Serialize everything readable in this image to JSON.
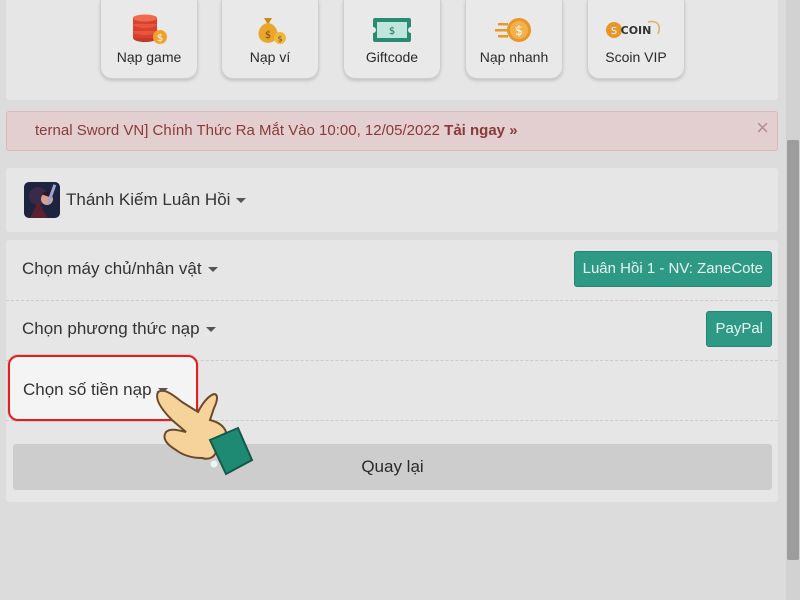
{
  "shortcuts": [
    {
      "label": "Nạp game",
      "icon": "coin-stack-icon"
    },
    {
      "label": "Nạp ví",
      "icon": "money-bag-icon"
    },
    {
      "label": "Giftcode",
      "icon": "ticket-icon"
    },
    {
      "label": "Nạp nhanh",
      "icon": "fast-coin-icon"
    },
    {
      "label": "Scoin VIP",
      "icon": "scoin-vip-logo"
    }
  ],
  "alert": {
    "text": "ternal Sword VN] Chính Thức Ra Mắt Vào 10:00, 12/05/2022",
    "link": "Tải ngay »",
    "close": "×"
  },
  "game": {
    "name": "Thánh Kiếm Luân Hồi"
  },
  "form": {
    "server_label": "Chọn máy chủ/nhân vật",
    "server_value": "Luân Hồi 1 - NV: ZaneCote",
    "method_label": "Chọn phương thức nạp",
    "method_value": "PayPal",
    "amount_label": "Chọn số tiền nạp"
  },
  "back_button": "Quay lại",
  "colors": {
    "accent": "#2e9a86",
    "alert_text": "#8a3a3a",
    "highlight": "#e02020"
  }
}
